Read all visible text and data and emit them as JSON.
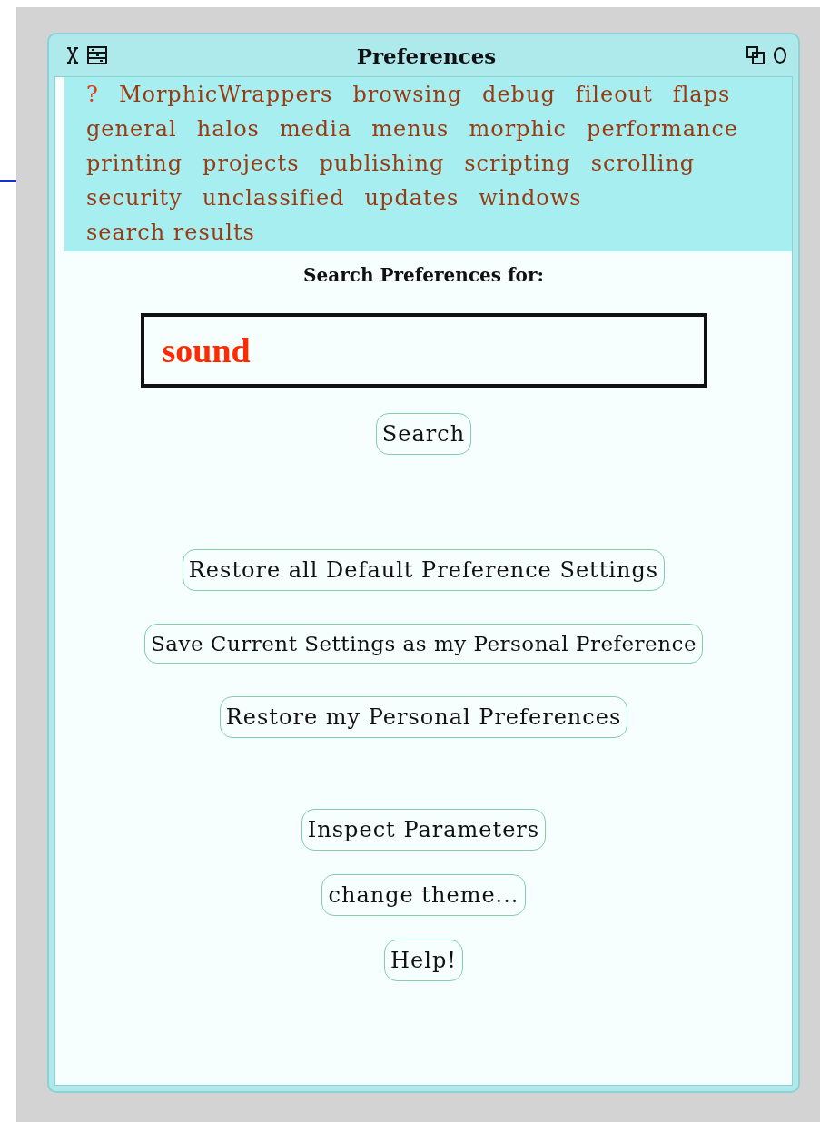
{
  "window": {
    "title": "Preferences"
  },
  "categories": [
    {
      "label": "?",
      "kind": "help"
    },
    {
      "label": "MorphicWrappers",
      "kind": "category"
    },
    {
      "label": "browsing",
      "kind": "category"
    },
    {
      "label": "debug",
      "kind": "category"
    },
    {
      "label": "fileout",
      "kind": "category"
    },
    {
      "label": "flaps",
      "kind": "category"
    },
    {
      "label": "general",
      "kind": "category"
    },
    {
      "label": "halos",
      "kind": "category"
    },
    {
      "label": "media",
      "kind": "category"
    },
    {
      "label": "menus",
      "kind": "category"
    },
    {
      "label": "morphic",
      "kind": "category"
    },
    {
      "label": "performance",
      "kind": "category"
    },
    {
      "label": "printing",
      "kind": "category"
    },
    {
      "label": "projects",
      "kind": "category"
    },
    {
      "label": "publishing",
      "kind": "category"
    },
    {
      "label": "scripting",
      "kind": "category"
    },
    {
      "label": "scrolling",
      "kind": "category"
    },
    {
      "label": "security",
      "kind": "category"
    },
    {
      "label": "unclassified",
      "kind": "category"
    },
    {
      "label": "updates",
      "kind": "category"
    },
    {
      "label": "windows",
      "kind": "category"
    },
    {
      "label": "search results",
      "kind": "category"
    }
  ],
  "search": {
    "heading": "Search Preferences for:",
    "value": "sound",
    "button": "Search"
  },
  "button_groups": [
    [
      "Restore all Default Preference Settings",
      "Save Current Settings as my Personal Preference",
      "Restore my Personal Preferences"
    ],
    [
      "Inspect Parameters",
      "change theme...",
      "Help!"
    ]
  ]
}
